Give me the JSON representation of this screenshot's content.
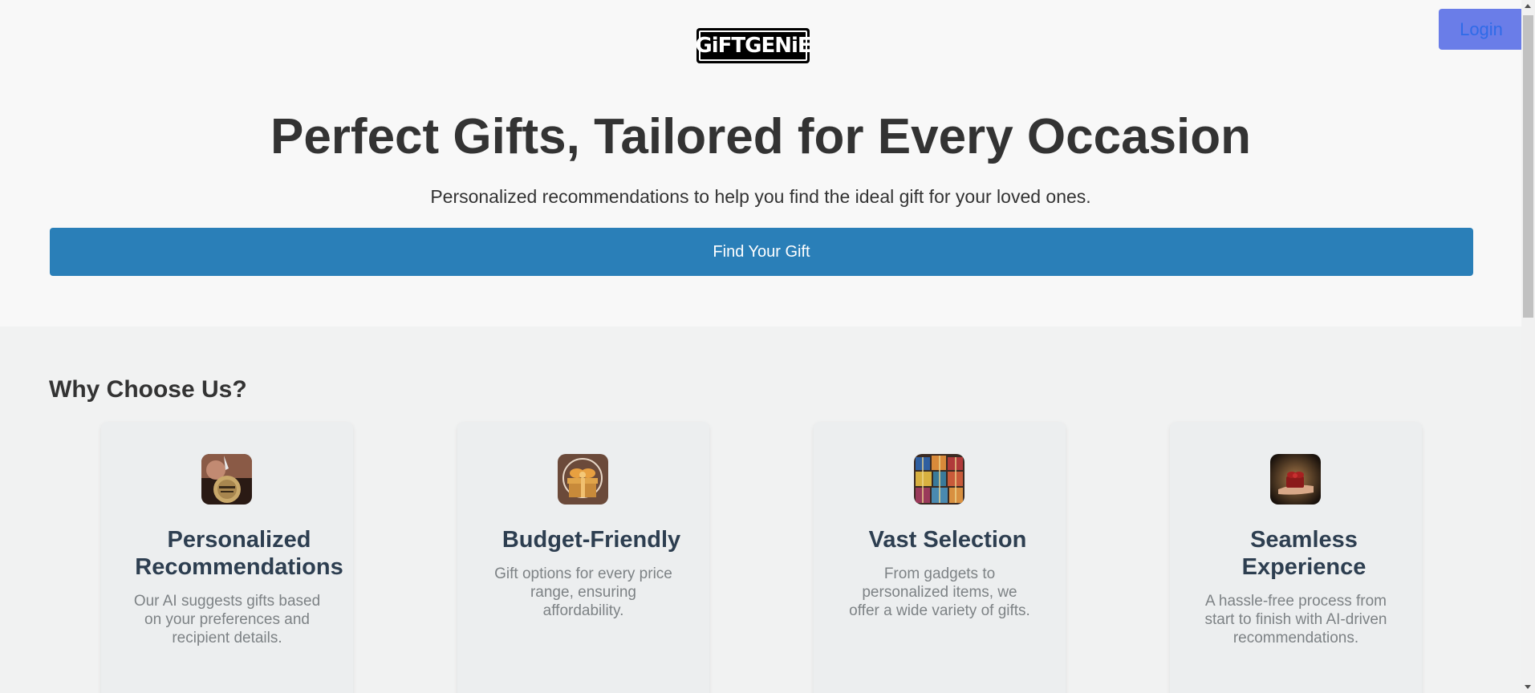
{
  "header": {
    "logo_text": "GiFTGENiE",
    "login_label": "Login"
  },
  "hero": {
    "title": "Perfect Gifts, Tailored for Every Occasion",
    "subtitle": "Personalized recommendations to help you find the ideal gift for your loved ones.",
    "cta_label": "Find Your Gift"
  },
  "features": {
    "title": "Why Choose Us?",
    "items": [
      {
        "icon": "medal-icon",
        "title": "Personalized Recommendations",
        "description": "Our AI suggests gifts based on your preferences and recipient details."
      },
      {
        "icon": "gift-box-icon",
        "title": "Budget-Friendly",
        "description": "Gift options for every price range, ensuring affordability."
      },
      {
        "icon": "gift-pile-icon",
        "title": "Vast Selection",
        "description": "From gadgets to personalized items, we offer a wide variety of gifts."
      },
      {
        "icon": "gift-in-hand-icon",
        "title": "Seamless Experience",
        "description": "A hassle-free process from start to finish with AI-driven recommendations."
      }
    ]
  },
  "colors": {
    "primary": "#2a7fb8",
    "login_bg": "#6a7de8",
    "heading": "#333333",
    "card_title": "#2d3e50"
  }
}
